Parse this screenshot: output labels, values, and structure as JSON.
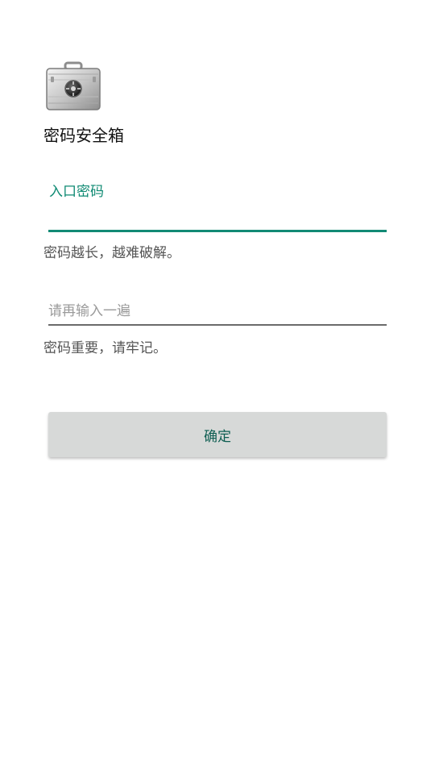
{
  "app": {
    "title": "密码安全箱",
    "logo_icon": "safe-briefcase-icon"
  },
  "form": {
    "password_label": "入口密码",
    "password_value": "",
    "password_hint": "密码越长，越难破解。",
    "confirm_placeholder": "请再输入一遍",
    "confirm_value": "",
    "confirm_hint": "密码重要，请牢记。",
    "submit_label": "确定"
  },
  "colors": {
    "accent": "#128a75",
    "button_bg": "#d7d9d8",
    "button_text": "#0f5e52",
    "helper_text": "#555555",
    "placeholder_text": "#9a9a9a"
  }
}
